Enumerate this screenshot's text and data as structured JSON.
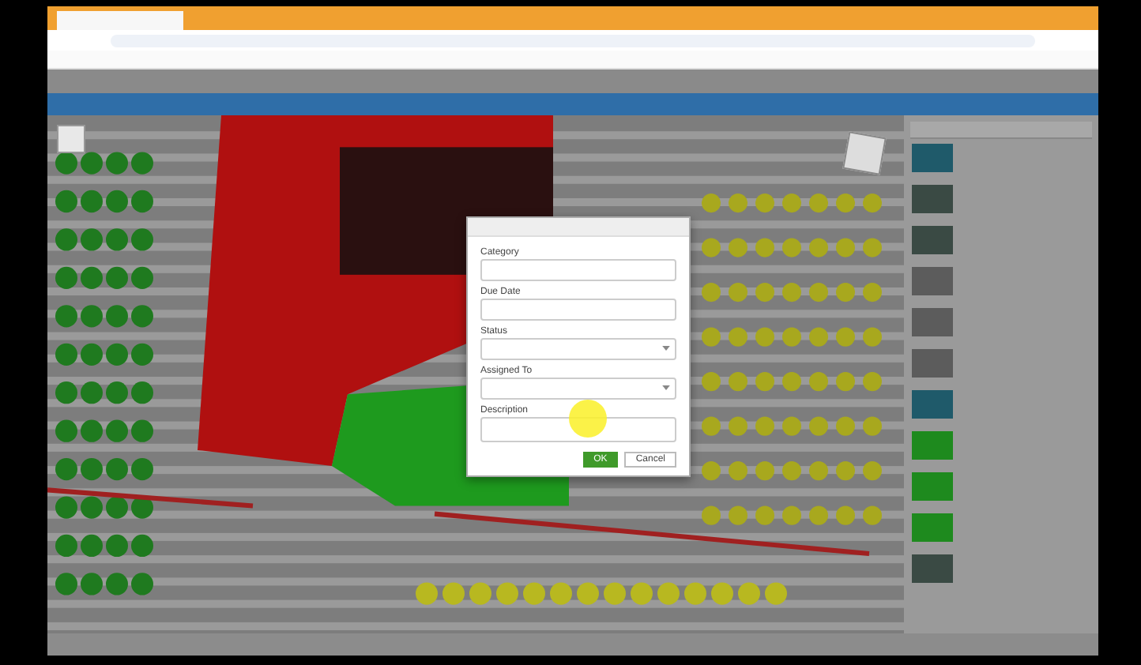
{
  "dialog": {
    "fields": [
      {
        "label": "Category",
        "kind": "text"
      },
      {
        "label": "Due Date",
        "kind": "text"
      },
      {
        "label": "Status",
        "kind": "select"
      },
      {
        "label": "Assigned To",
        "kind": "select"
      },
      {
        "label": "Description",
        "kind": "textarea"
      }
    ],
    "buttons": [
      {
        "label": "OK",
        "kind": "primary"
      },
      {
        "label": "Cancel",
        "kind": "secondary"
      }
    ]
  },
  "sidebar": {
    "items": [
      {
        "kind": "water"
      },
      {
        "kind": "ring"
      },
      {
        "kind": "ring"
      },
      {
        "kind": "grey"
      },
      {
        "kind": "grey"
      },
      {
        "kind": "grey"
      },
      {
        "kind": "water"
      },
      {
        "kind": "green"
      },
      {
        "kind": "green"
      },
      {
        "kind": "green"
      },
      {
        "kind": "ring"
      }
    ]
  }
}
